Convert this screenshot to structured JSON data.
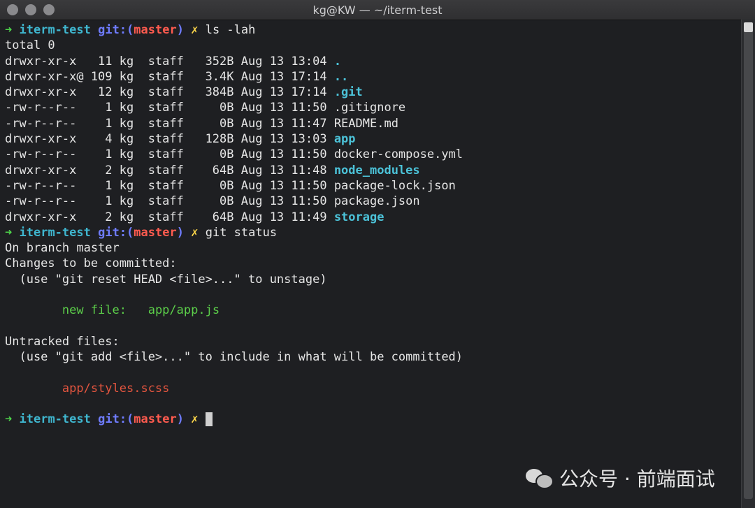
{
  "window": {
    "title": "kg@KW — ~/iterm-test"
  },
  "prompt": {
    "arrow": "➜",
    "dir": "iterm-test",
    "git": "git:(",
    "branch": "master",
    "git_close": ")",
    "dirty": "✗"
  },
  "commands": {
    "ls": "ls -lah",
    "status": "git status"
  },
  "ls_output": {
    "total": "total 0",
    "rows": [
      {
        "meta": "drwxr-xr-x   11 kg  staff   352B Aug 13 13:04 ",
        "name": ".",
        "type": "dir"
      },
      {
        "meta": "drwxr-xr-x@ 109 kg  staff   3.4K Aug 13 17:14 ",
        "name": "..",
        "type": "dir"
      },
      {
        "meta": "drwxr-xr-x   12 kg  staff   384B Aug 13 17:14 ",
        "name": ".git",
        "type": "dir"
      },
      {
        "meta": "-rw-r--r--    1 kg  staff     0B Aug 13 11:50 ",
        "name": ".gitignore",
        "type": "file"
      },
      {
        "meta": "-rw-r--r--    1 kg  staff     0B Aug 13 11:47 ",
        "name": "README.md",
        "type": "file"
      },
      {
        "meta": "drwxr-xr-x    4 kg  staff   128B Aug 13 13:03 ",
        "name": "app",
        "type": "dir"
      },
      {
        "meta": "-rw-r--r--    1 kg  staff     0B Aug 13 11:50 ",
        "name": "docker-compose.yml",
        "type": "file"
      },
      {
        "meta": "drwxr-xr-x    2 kg  staff    64B Aug 13 11:48 ",
        "name": "node_modules",
        "type": "dir"
      },
      {
        "meta": "-rw-r--r--    1 kg  staff     0B Aug 13 11:50 ",
        "name": "package-lock.json",
        "type": "file"
      },
      {
        "meta": "-rw-r--r--    1 kg  staff     0B Aug 13 11:50 ",
        "name": "package.json",
        "type": "file"
      },
      {
        "meta": "drwxr-xr-x    2 kg  staff    64B Aug 13 11:49 ",
        "name": "storage",
        "type": "dir"
      }
    ]
  },
  "status_output": {
    "branch_line": "On branch master",
    "staged_header": "Changes to be committed:",
    "staged_hint": "  (use \"git reset HEAD <file>...\" to unstage)",
    "staged_label": "        new file:   ",
    "staged_file": "app/app.js",
    "untracked_header": "Untracked files:",
    "untracked_hint": "  (use \"git add <file>...\" to include in what will be committed)",
    "untracked_file": "        app/styles.scss"
  },
  "watermark": {
    "text": "公众号 · 前端面试"
  },
  "colors": {
    "prompt_arrow": "#4ed54b",
    "prompt_dir": "#3fb6cf",
    "git": "#6f7cff",
    "branch": "#ff5b4f",
    "dirty": "#ffd84a",
    "staged": "#5ccf4a",
    "untracked": "#e3553f",
    "background": "#1e1f22"
  }
}
